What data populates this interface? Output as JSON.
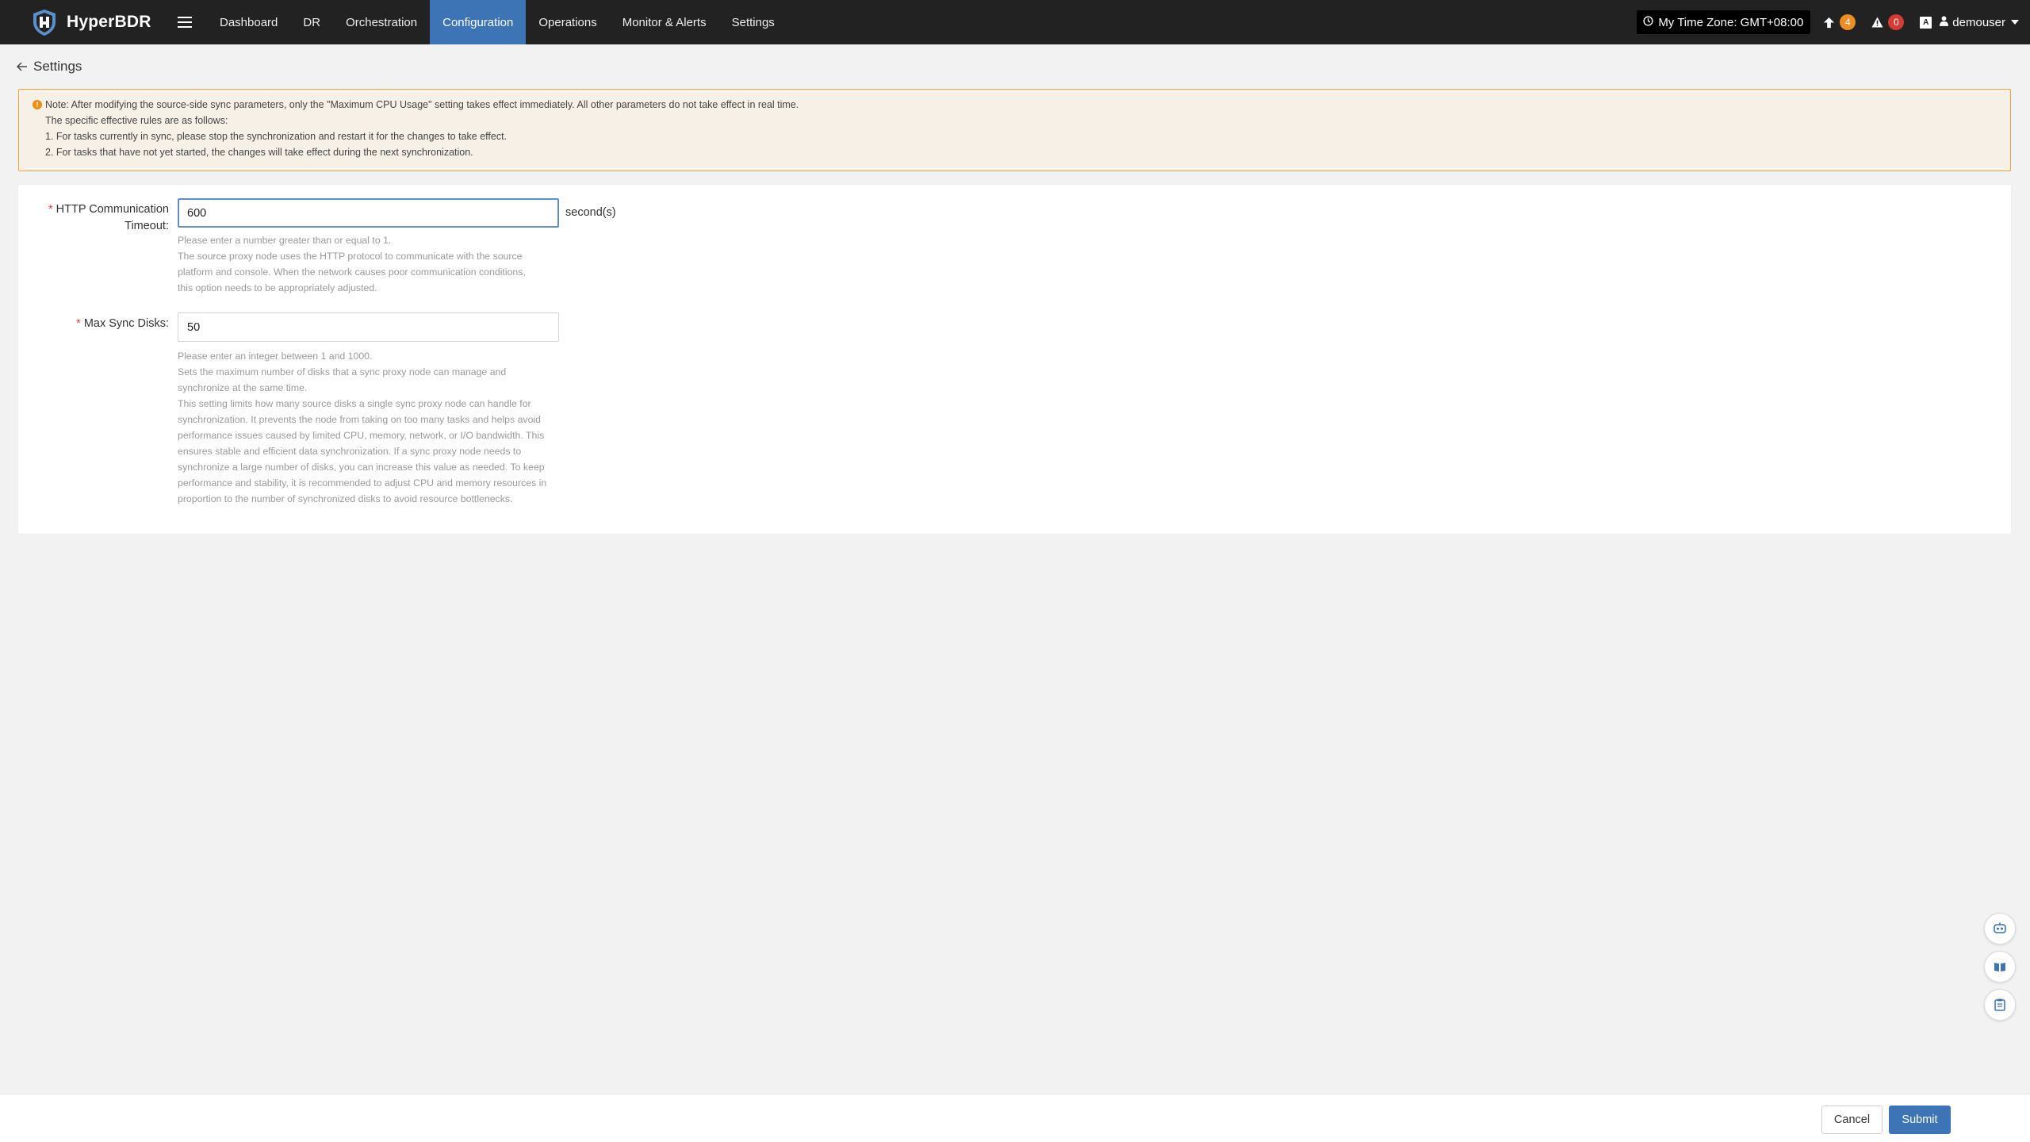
{
  "app": {
    "name": "HyperBDR"
  },
  "nav": {
    "items": [
      {
        "label": "Dashboard",
        "active": false
      },
      {
        "label": "DR",
        "active": false
      },
      {
        "label": "Orchestration",
        "active": false
      },
      {
        "label": "Configuration",
        "active": true
      },
      {
        "label": "Operations",
        "active": false
      },
      {
        "label": "Monitor & Alerts",
        "active": false
      },
      {
        "label": "Settings",
        "active": false
      }
    ],
    "timezone": "My Time Zone: GMT+08:00",
    "upgrade_count": "4",
    "alert_count": "0",
    "user": "demouser"
  },
  "page": {
    "title": "Settings"
  },
  "notice": {
    "line1": "Note: After modifying the source-side sync parameters, only the \"Maximum CPU Usage\" setting takes effect immediately. All other parameters do not take effect in real time.",
    "line2": "The specific effective rules are as follows:",
    "line3": "1. For tasks currently in sync, please stop the synchronization and restart it for the changes to take effect.",
    "line4": "2. For tasks that have not yet started, the changes will take effect during the next synchronization."
  },
  "form": {
    "timeout": {
      "label_line1": "HTTP Communication",
      "label_line2": "Timeout:",
      "value": "600",
      "unit": "second(s)",
      "help1": "Please enter a number greater than or equal to 1.",
      "help2": "The source proxy node uses the HTTP protocol to communicate with the source platform and console. When the network causes poor communication conditions, this option needs to be appropriately adjusted."
    },
    "max_disks": {
      "label": "Max Sync Disks:",
      "value": "50",
      "help1": "Please enter an integer between 1 and 1000.",
      "help2": "Sets the maximum number of disks that a sync proxy node can manage and synchronize at the same time.",
      "help3": "This setting limits how many source disks a single sync proxy node can handle for synchronization. It prevents the node from taking on too many tasks and helps avoid performance issues caused by limited CPU, memory, network, or I/O bandwidth. This ensures stable and efficient data synchronization. If a sync proxy node needs to synchronize a large number of disks, you can increase this value as needed. To keep performance and stability, it is recommended to adjust CPU and memory resources in proportion to the number of synchronized disks to avoid resource bottlenecks."
    }
  },
  "footer": {
    "cancel": "Cancel",
    "submit": "Submit"
  },
  "colors": {
    "navbar": "#222222",
    "accent": "#3d74b5",
    "notice_bg": "#f7f0e6",
    "notice_border": "#f0a23c",
    "badge_orange": "#ee8d22",
    "badge_red": "#d63a33"
  },
  "icons": {
    "logo": "shield-logo-icon",
    "menu": "hamburger-icon",
    "timezone": "clock-icon",
    "upgrade": "arrow-up-icon",
    "alerts": "warning-icon",
    "ai": "ai-icon",
    "user": "user-icon",
    "back": "arrow-left-icon",
    "notice": "exclamation-circle-icon",
    "float1": "robot-icon",
    "float2": "book-icon",
    "float3": "clipboard-icon"
  }
}
